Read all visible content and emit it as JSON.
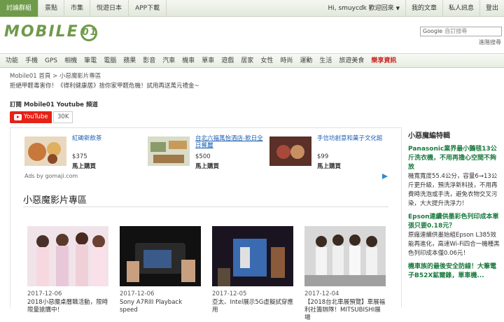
{
  "topnav": {
    "tabs": [
      {
        "label": "討論群組",
        "active": true
      },
      {
        "label": "景點",
        "active": false
      },
      {
        "label": "市集",
        "active": false
      },
      {
        "label": "悅遊日本",
        "active": false
      },
      {
        "label": "APP下載",
        "active": false
      }
    ],
    "greeting": "Hi, smuycdk 歡迎回來",
    "greeting_caret": "▼",
    "my_articles": "我的文章",
    "private_messages": "私人訊息",
    "logout": "登出"
  },
  "header": {
    "logo_text": "MOBILE",
    "logo_mark": "01",
    "search_brand": "Google",
    "search_placeholder": "自訂搜尋",
    "advanced_search": "進階搜尋"
  },
  "categories": [
    {
      "label": "功能",
      "hot": false
    },
    {
      "label": "手機",
      "hot": false
    },
    {
      "label": "GPS",
      "hot": false
    },
    {
      "label": "相機",
      "hot": false
    },
    {
      "label": "筆電",
      "hot": false
    },
    {
      "label": "電腦",
      "hot": false
    },
    {
      "label": "蘋果",
      "hot": false
    },
    {
      "label": "影音",
      "hot": false
    },
    {
      "label": "汽車",
      "hot": false
    },
    {
      "label": "機車",
      "hot": false
    },
    {
      "label": "單車",
      "hot": false
    },
    {
      "label": "遊戲",
      "hot": false
    },
    {
      "label": "居家",
      "hot": false
    },
    {
      "label": "女性",
      "hot": false
    },
    {
      "label": "時尚",
      "hot": false
    },
    {
      "label": "運動",
      "hot": false
    },
    {
      "label": "生活",
      "hot": false
    },
    {
      "label": "旅遊美食",
      "hot": false
    },
    {
      "label": "樂享資訊",
      "hot": true
    }
  ],
  "breadcrumb": "Mobile01 首頁 > 小惡魔影片專區",
  "promo_text": "拒絕甲醛毒害你！《得利健康居》捨你家甲醛危機！試用再送萬元禮金~",
  "youtube": {
    "subtitle": "訂閱 Mobile01 Youtube 頻道",
    "button_label": "YouTube",
    "count": "30K"
  },
  "ads": {
    "items": [
      {
        "title": "紅磡新飲茶",
        "price": "$375",
        "buy": "馬上購買",
        "img_color": "#c8783a"
      },
      {
        "title": "台北六福萬怡酒店-飲日全日餐麗",
        "price": "$500",
        "buy": "馬上購買",
        "img_color": "#8a9b6a"
      },
      {
        "title": "手信坊創意和菓子文化館",
        "price": "$99",
        "buy": "馬上購買",
        "img_color": "#a84a3a"
      }
    ],
    "ads_by": "Ads by gomaji.com"
  },
  "section_title": "小惡魔影片專區",
  "videos": [
    {
      "date": "2017-12-06",
      "title": "2018小惡魔桌曆職活動，限時限量搶購中！",
      "thumb": "girls"
    },
    {
      "date": "2017-12-06",
      "title": "Sony A7RIII Playback speed",
      "thumb": "camera"
    },
    {
      "date": "2017-12-05",
      "title": "亞太、Intel展示5G虛擬試穿應用",
      "thumb": "tv"
    },
    {
      "date": "2017-12-04",
      "title": "【2018台北車展預覽】車展福利社籌辦隊！MITSUBISHI展場",
      "thumb": "models"
    }
  ],
  "sidebar": {
    "heading": "小惡魔編特輯",
    "articles": [
      {
        "title": "Panasonic業界最小鵝毯13公斤洗衣機，不用再擔心空間不夠放",
        "text": "機寬寬度55.4公分，容量6→13公斤更升級，預洗淨新科技，不用再費時洗泡或手洗，避免衣物交叉污染，大大提升洗淨力！"
      },
      {
        "title": "Epson連續供墨彩色列印成本單張只要0.18元？",
        "text": "原廠連續供墨始組Epson L385效能再進化，高速Wi-Fi四合一機種黑色列印成本僅0.06元！"
      },
      {
        "title": "機車族的最後安全防線！大筆電子B52X鉱爾錄，單車機..."
      }
    ]
  },
  "colors": {
    "brand_green": "#6f9a4a",
    "link_blue": "#1a5fb4",
    "sidebar_green": "#1a7a3e",
    "youtube_red": "#e62117"
  }
}
